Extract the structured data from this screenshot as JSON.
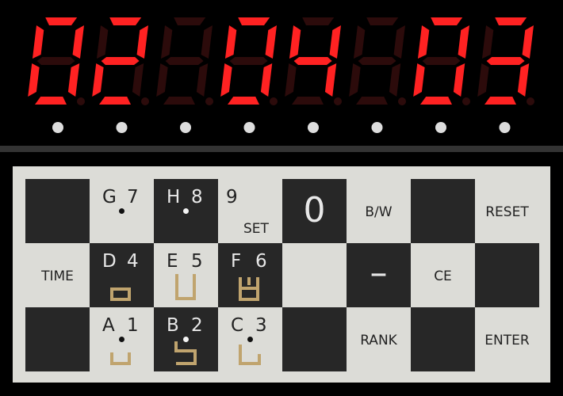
{
  "display": {
    "digits": [
      "0",
      "2",
      "",
      "0",
      "4",
      "",
      "0",
      "3"
    ],
    "on_color": "#ff2222",
    "off_color": "#2c0b0b",
    "led_dot_color": "#dddddd"
  },
  "keypad": {
    "keys": [
      {
        "id": "blank-a",
        "text": "",
        "number": "",
        "dark": true
      },
      {
        "id": "g7",
        "text": "G",
        "number": "7",
        "dark": false,
        "dot": true
      },
      {
        "id": "h8",
        "text": "H",
        "number": "8",
        "dark": true,
        "dot": true
      },
      {
        "id": "9-set",
        "text": "",
        "number": "9",
        "sub": "SET",
        "dark": false
      },
      {
        "id": "0",
        "big": "0",
        "dark": true
      },
      {
        "id": "bw",
        "center": "B/W",
        "dark": false
      },
      {
        "id": "blank-b",
        "text": "",
        "dark": true
      },
      {
        "id": "reset",
        "center": "RESET",
        "dark": false
      },
      {
        "id": "time",
        "center": "TIME",
        "dark": false
      },
      {
        "id": "d4",
        "text": "D",
        "number": "4",
        "dark": true,
        "icon": "rook-icon"
      },
      {
        "id": "e5",
        "text": "E",
        "number": "5",
        "dark": false,
        "icon": "queen-icon"
      },
      {
        "id": "f6",
        "text": "F",
        "number": "6",
        "dark": true,
        "icon": "king-icon"
      },
      {
        "id": "blank-c",
        "text": "",
        "dark": false
      },
      {
        "id": "minus",
        "center": "–",
        "dark": true,
        "large": true
      },
      {
        "id": "ce",
        "center": "CE",
        "dark": false
      },
      {
        "id": "blank-d",
        "text": "",
        "dark": true
      },
      {
        "id": "blank-e",
        "text": "",
        "dark": true
      },
      {
        "id": "a1",
        "text": "A",
        "number": "1",
        "dark": false,
        "dot": true,
        "icon": "pawn-icon"
      },
      {
        "id": "b2",
        "text": "B",
        "number": "2",
        "dark": true,
        "dot": true,
        "icon": "knight-icon"
      },
      {
        "id": "c3",
        "text": "C",
        "number": "3",
        "dark": false,
        "dot": true,
        "icon": "bishop-icon"
      },
      {
        "id": "blank-f",
        "text": "",
        "dark": true
      },
      {
        "id": "rank",
        "center": "RANK",
        "dark": false
      },
      {
        "id": "blank-g",
        "text": "",
        "dark": true
      },
      {
        "id": "enter",
        "center": "ENTER",
        "dark": false
      }
    ],
    "light_color": "#dcdcd7",
    "dark_color": "#272727",
    "icon_color": "#c0a46e"
  }
}
